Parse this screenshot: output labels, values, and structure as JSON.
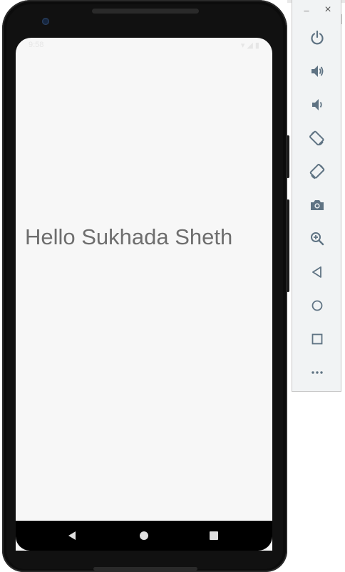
{
  "app": {
    "hello_text": "Hello Sukhada Sheth"
  },
  "status_bar": {
    "time": "9:58",
    "icons": "▾ ◢ ▮"
  },
  "toolbar": {
    "minimize_label": "–",
    "close_label": "×",
    "buttons": [
      {
        "name": "power-icon"
      },
      {
        "name": "volume-up-icon"
      },
      {
        "name": "volume-down-icon"
      },
      {
        "name": "rotate-left-icon"
      },
      {
        "name": "rotate-right-icon"
      },
      {
        "name": "camera-icon"
      },
      {
        "name": "zoom-icon"
      },
      {
        "name": "back-icon"
      },
      {
        "name": "home-icon"
      },
      {
        "name": "overview-icon"
      },
      {
        "name": "more-icon"
      }
    ],
    "icon_color": "#5f7383"
  }
}
